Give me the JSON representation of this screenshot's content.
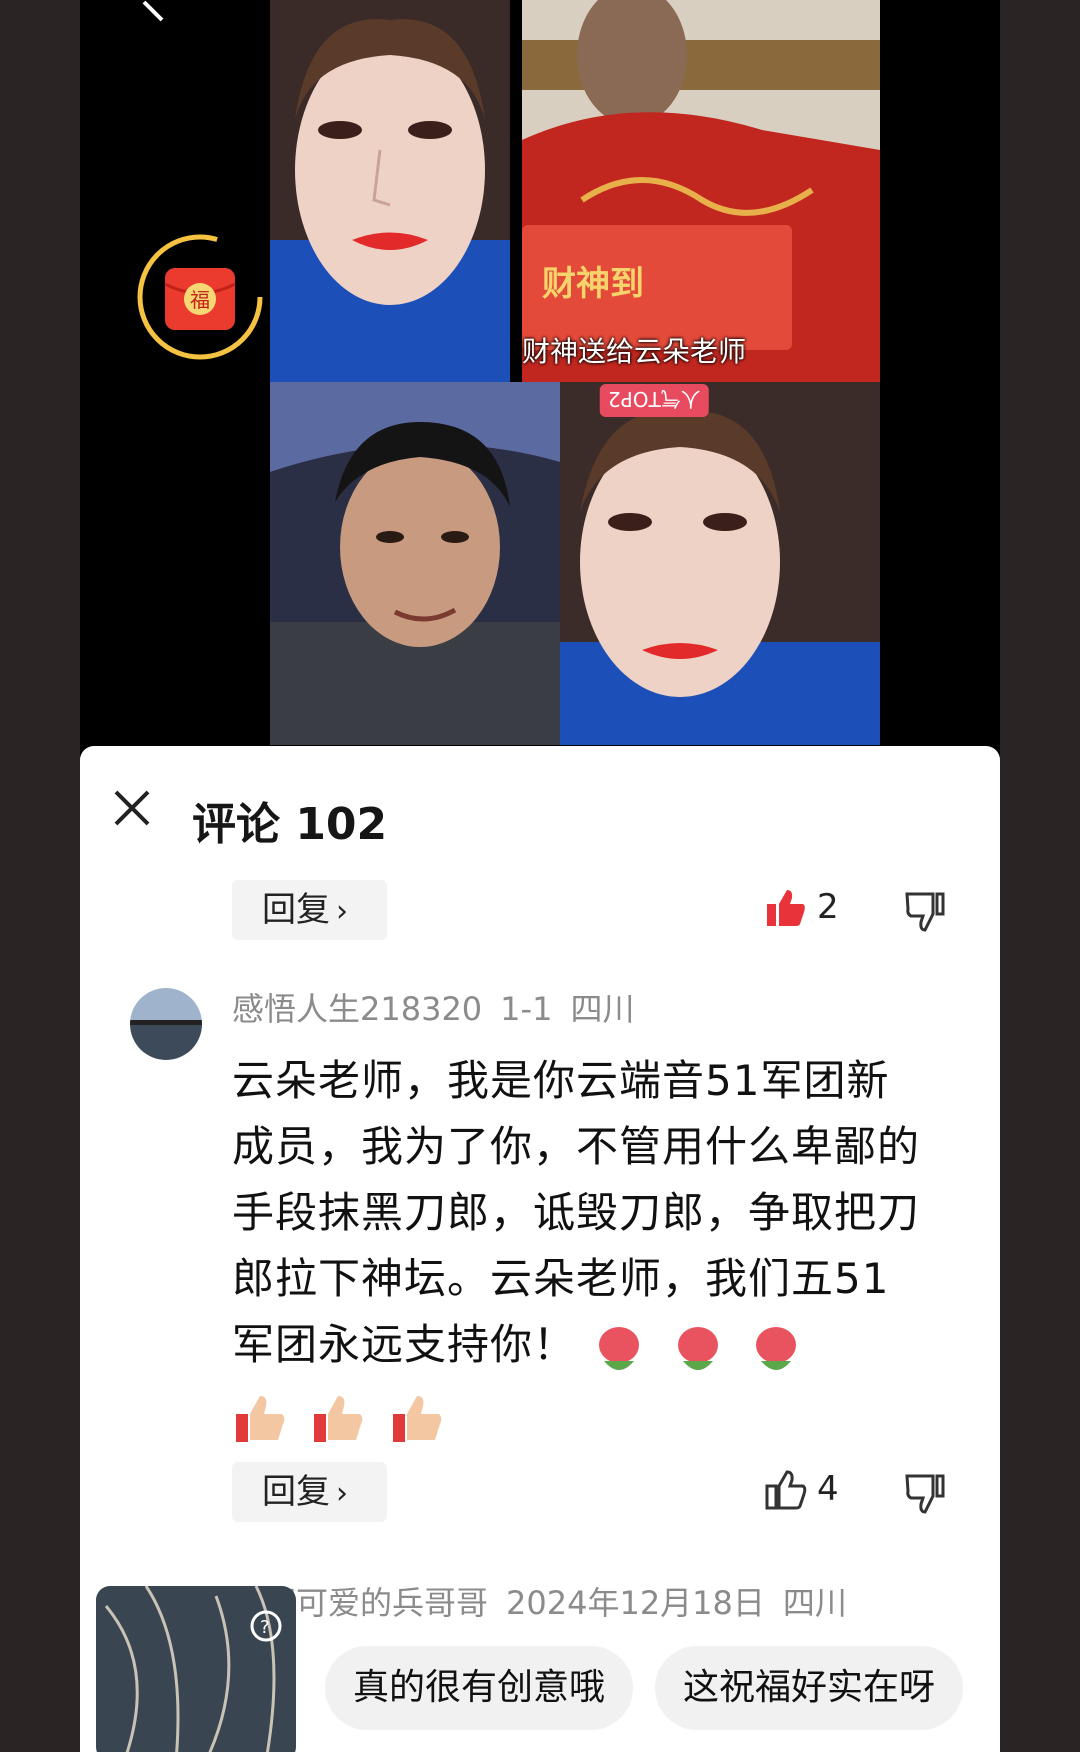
{
  "comments_panel": {
    "title": "评论 102",
    "reply_label": "回复",
    "reply_chevron": "›",
    "comments": [
      {
        "likes": "2",
        "liked": true
      },
      {
        "username": "感悟人生218320",
        "date": "1-1",
        "location": "四川",
        "text": "云朵老师，我是你云端音51军团新成员，我为了你，不管用什么卑鄙的手段抹黑刀郎，诋毁刀郎，争取把刀郎拉下神坛。云朵老师，我们五51军团永远支持你！",
        "emojis": [
          "rose-emoji",
          "rose-emoji",
          "rose-emoji",
          "thumbs-up-emoji",
          "thumbs-up-emoji",
          "thumbs-up-emoji"
        ],
        "likes": "4",
        "liked": false
      },
      {
        "username": "浑浑可爱的兵哥哥",
        "date": "2024年12月18日",
        "location": "四川"
      }
    ],
    "quick_replies": [
      "真的很有创意哦",
      "这祝福好实在呀"
    ]
  },
  "video": {
    "caption": "财神送给云朵老师",
    "rank_badge": "人气TOP2",
    "redpacket_char": "福"
  },
  "colors": {
    "accent_red": "#e8333b",
    "panel_bg": "#ffffff"
  }
}
